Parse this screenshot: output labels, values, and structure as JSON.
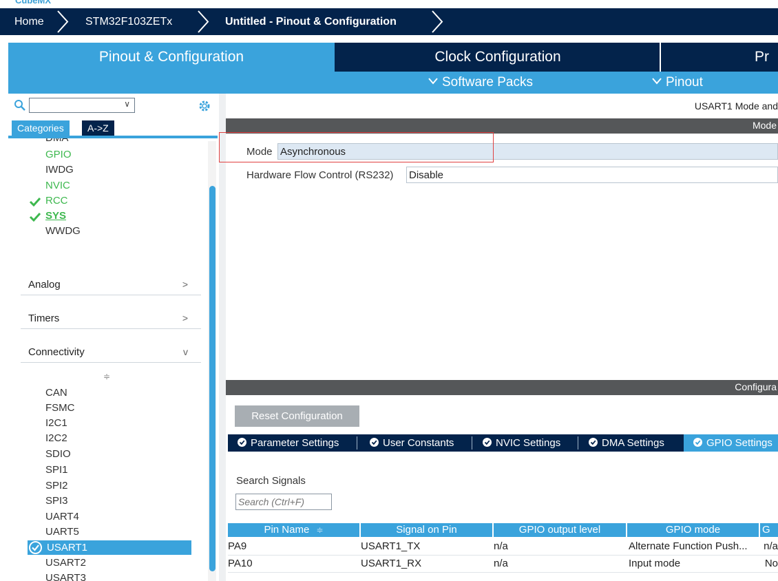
{
  "app": {
    "name_fragment": "CubeMX"
  },
  "breadcrumb": [
    {
      "label": "Home"
    },
    {
      "label": "STM32F103ZETx"
    },
    {
      "label": "Untitled - Pinout & Configuration"
    }
  ],
  "main_tabs": [
    {
      "label": "Pinout & Configuration"
    },
    {
      "label": "Clock Configuration"
    },
    {
      "label": "Pr"
    }
  ],
  "sub_menu": [
    {
      "label": "Software Packs",
      "icon": "chevron-down-icon"
    },
    {
      "label": "Pinout",
      "icon": "chevron-down-icon"
    }
  ],
  "left": {
    "search": {
      "value": ""
    },
    "tabs": {
      "categories": "Categories",
      "az": "A->Z"
    },
    "system_core": [
      {
        "label": "DMA",
        "checked": false,
        "green": false
      },
      {
        "label": "GPIO",
        "checked": false,
        "green": true
      },
      {
        "label": "IWDG",
        "checked": false,
        "green": false
      },
      {
        "label": "NVIC",
        "checked": false,
        "green": true
      },
      {
        "label": "RCC",
        "checked": true,
        "green": true
      },
      {
        "label": "SYS",
        "checked": true,
        "green": true
      },
      {
        "label": "WWDG",
        "checked": false,
        "green": false
      }
    ],
    "sections": [
      {
        "label": "Analog",
        "arrow": ">"
      },
      {
        "label": "Timers",
        "arrow": ">"
      },
      {
        "label": "Connectivity",
        "arrow": "v"
      }
    ],
    "connectivity": [
      "CAN",
      "FSMC",
      "I2C1",
      "I2C2",
      "SDIO",
      "SPI1",
      "SPI2",
      "SPI3",
      "UART4",
      "UART5",
      "USART1",
      "USART2",
      "USART3"
    ],
    "selected": "USART1",
    "sort_glyph": "≑"
  },
  "right": {
    "mode_title": "USART1 Mode and",
    "mode_bar": "Mode",
    "mode_label": "Mode",
    "mode_value": "Asynchronous",
    "hfc_label": "Hardware Flow Control (RS232)",
    "hfc_value": "Disable",
    "config_bar": "Configura",
    "reset_label": "Reset Configuration",
    "config_tabs": [
      {
        "label": "Parameter Settings"
      },
      {
        "label": "User Constants"
      },
      {
        "label": "NVIC Settings"
      },
      {
        "label": "DMA Settings"
      },
      {
        "label": "GPIO Settings"
      }
    ],
    "search_signals_label": "Search Signals",
    "search_placeholder": "Search (Ctrl+F)",
    "table": {
      "headers": [
        "Pin Name",
        "Signal on Pin",
        "GPIO output level",
        "GPIO mode",
        "G"
      ],
      "sort_glyph": "≑",
      "rows": [
        [
          "PA9",
          "USART1_TX",
          "n/a",
          "Alternate Function Push...",
          "n/a"
        ],
        [
          "PA10",
          "USART1_RX",
          "n/a",
          "Input mode",
          "No"
        ]
      ]
    }
  },
  "colors": {
    "navy": "#03234b",
    "accent": "#3aa3dc",
    "check": "#3db84e",
    "highlight": "#e04040"
  }
}
